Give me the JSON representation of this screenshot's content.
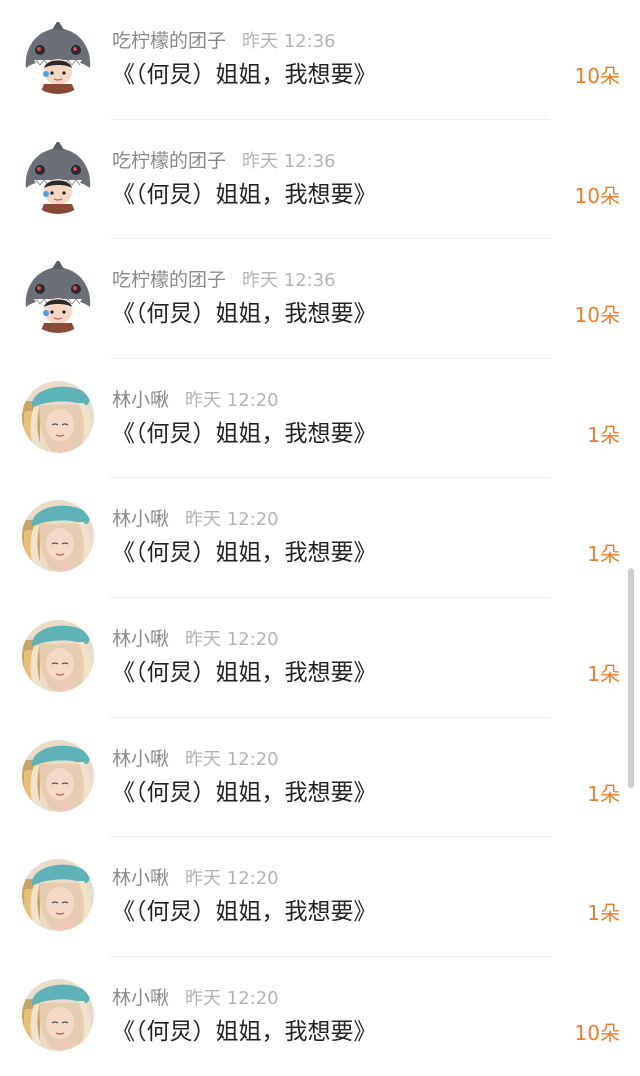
{
  "rows": [
    {
      "avatar": "shark-hoodie-avatar",
      "name": "吃柠檬的团子",
      "time": "昨天 12:36",
      "message": "《（何炅）姐姐，我想要》",
      "count": "10朵"
    },
    {
      "avatar": "shark-hoodie-avatar",
      "name": "吃柠檬的团子",
      "time": "昨天 12:36",
      "message": "《（何炅）姐姐，我想要》",
      "count": "10朵"
    },
    {
      "avatar": "shark-hoodie-avatar",
      "name": "吃柠檬的团子",
      "time": "昨天 12:36",
      "message": "《（何炅）姐姐，我想要》",
      "count": "10朵"
    },
    {
      "avatar": "girl-teal-hat-avatar",
      "name": "林小啾",
      "time": "昨天 12:20",
      "message": "《（何炅）姐姐，我想要》",
      "count": "1朵"
    },
    {
      "avatar": "girl-teal-hat-avatar",
      "name": "林小啾",
      "time": "昨天 12:20",
      "message": "《（何炅）姐姐，我想要》",
      "count": "1朵"
    },
    {
      "avatar": "girl-teal-hat-avatar",
      "name": "林小啾",
      "time": "昨天 12:20",
      "message": "《（何炅）姐姐，我想要》",
      "count": "1朵"
    },
    {
      "avatar": "girl-teal-hat-avatar",
      "name": "林小啾",
      "time": "昨天 12:20",
      "message": "《（何炅）姐姐，我想要》",
      "count": "1朵"
    },
    {
      "avatar": "girl-teal-hat-avatar",
      "name": "林小啾",
      "time": "昨天 12:20",
      "message": "《（何炅）姐姐，我想要》",
      "count": "1朵"
    },
    {
      "avatar": "girl-teal-hat-avatar",
      "name": "林小啾",
      "time": "昨天 12:20",
      "message": "《（何炅）姐姐，我想要》",
      "count": "10朵"
    }
  ],
  "colors": {
    "count": "#f07c2a",
    "name": "#8a8a8a",
    "time": "#b4b4b4",
    "message": "#222222"
  }
}
